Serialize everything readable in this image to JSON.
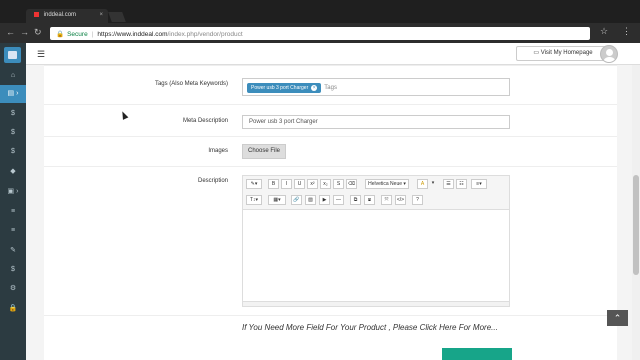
{
  "browser": {
    "tab_title": "inddeal.com",
    "tab_close": "×",
    "secure_label": "Secure",
    "url_host": "https://www.inddeal.com",
    "url_path": "/index.php/vendor/product"
  },
  "header": {
    "visit_label": "Visit My Homepage"
  },
  "sidebar": {
    "items": [
      "⌂",
      "▤ ›",
      "$",
      "$",
      "$",
      "◆",
      "▣ ›",
      "≡",
      "≡",
      "✎",
      "$",
      "⚙",
      "🔒"
    ]
  },
  "form": {
    "tags_label": "Tags (Also Meta Keywords)",
    "tag_chip": "Power usb 3 port Charger",
    "tag_chip_remove": "×",
    "tags_placeholder": "Tags",
    "meta_label": "Meta Description",
    "meta_value": "Power usb 3 port Charger",
    "images_label": "Images",
    "choose_file": "Choose File",
    "description_label": "Description",
    "font_select": "Helvetica Neue",
    "more_link": "If You Need More Field For Your Product , Please Click Here For More..."
  },
  "toolbar": {
    "buttons": [
      "✎▾",
      "B",
      "I",
      "U",
      "x²",
      "x₂",
      "S",
      "⌫",
      "A",
      "▾",
      "☰",
      "☷",
      "≡▾",
      "T↕▾",
      "▦▾",
      "🔗",
      "▨",
      "▶",
      "—",
      "⧉",
      "⧈",
      "⤧",
      "</>",
      "?"
    ]
  },
  "colors": {
    "accent": "#3c8dbc",
    "sidebar_bg": "#2c3b41",
    "submit_green": "#17a589"
  }
}
